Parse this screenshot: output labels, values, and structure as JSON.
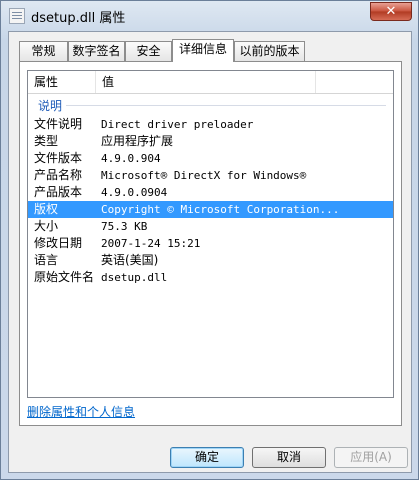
{
  "window": {
    "title": "dsetup.dll 属性",
    "close_label": "✕"
  },
  "tabs": [
    {
      "label": "常规"
    },
    {
      "label": "数字签名"
    },
    {
      "label": "安全"
    },
    {
      "label": "详细信息"
    },
    {
      "label": "以前的版本"
    }
  ],
  "list": {
    "col_property": "属性",
    "col_value": "值",
    "group": "说明",
    "rows": [
      {
        "key": "文件说明",
        "value": "Direct driver preloader"
      },
      {
        "key": "类型",
        "value": "应用程序扩展"
      },
      {
        "key": "文件版本",
        "value": "4.9.0.904"
      },
      {
        "key": "产品名称",
        "value": "Microsoft® DirectX for Windows®"
      },
      {
        "key": "产品版本",
        "value": "4.9.0.0904"
      },
      {
        "key": "版权",
        "value": "Copyright © Microsoft Corporation..."
      },
      {
        "key": "大小",
        "value": "75.3 KB"
      },
      {
        "key": "修改日期",
        "value": "2007-1-24 15:21"
      },
      {
        "key": "语言",
        "value": "英语(美国)"
      },
      {
        "key": "原始文件名",
        "value": "dsetup.dll"
      }
    ]
  },
  "remove_link": "删除属性和个人信息",
  "buttons": {
    "ok": "确定",
    "cancel": "取消",
    "apply": "应用(A)"
  },
  "colors": {
    "selection": "#3399ff",
    "link": "#0066cc",
    "group": "#1e5bb8"
  }
}
